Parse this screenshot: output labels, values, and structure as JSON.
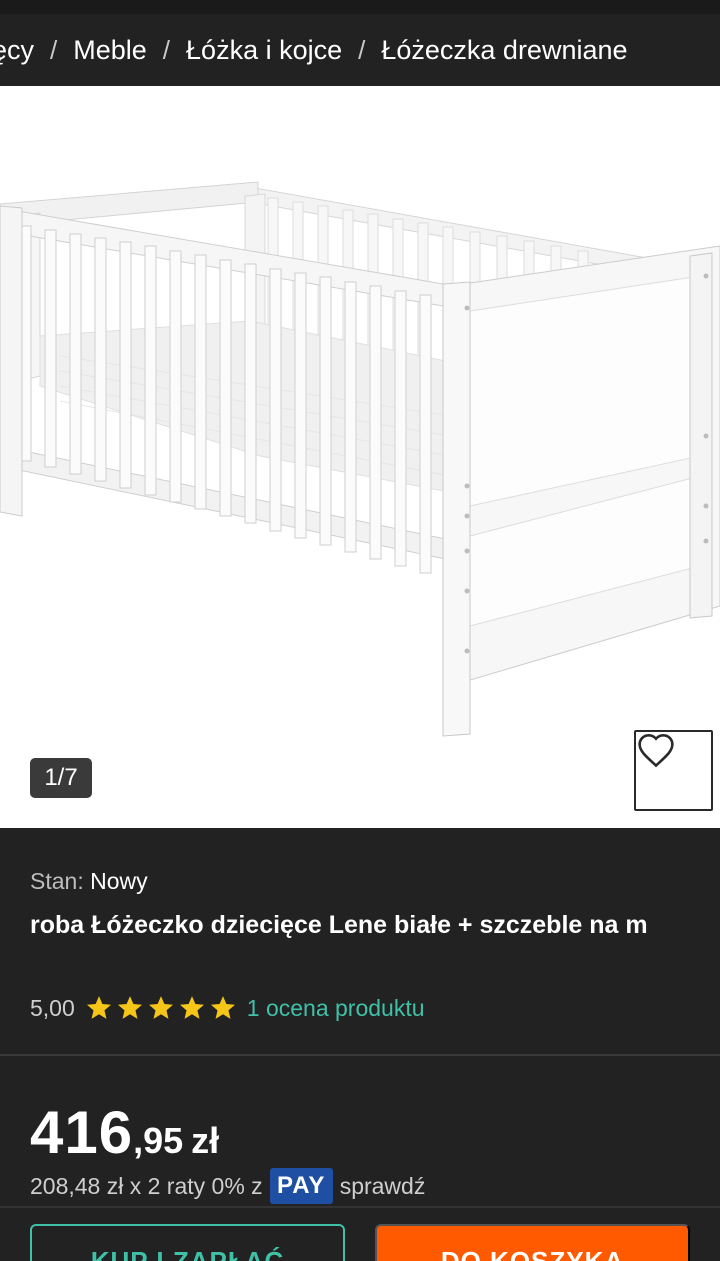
{
  "breadcrumb": {
    "items": [
      "ięcy",
      "Meble",
      "Łóżka i kojce",
      "Łóżeczka drewniane"
    ],
    "separator": "/"
  },
  "gallery": {
    "counter": "1/7",
    "favorite_icon": "heart-outline-icon"
  },
  "product": {
    "condition_label": "Stan:",
    "condition_value": "Nowy",
    "title": "roba Łóżeczko dziecięce Lene białe + szczeble na m",
    "rating_value": "5,00",
    "stars": 5,
    "rating_link": "1 ocena produktu"
  },
  "price": {
    "main": "416",
    "cents": ",95",
    "currency": "zł"
  },
  "installments": {
    "text": "208,48 zł x 2 raty 0% z",
    "badge": "PAY",
    "link": "sprawdź"
  },
  "actions": {
    "buy_now": "KUP I ZAPŁAĆ",
    "add_to_cart": "DO KOSZYKA"
  },
  "colors": {
    "accent_teal": "#3fc1a8",
    "cart_orange": "#ff5a00",
    "star_yellow": "#f5c518",
    "pay_blue": "#1e4fa3",
    "background": "#222222"
  }
}
